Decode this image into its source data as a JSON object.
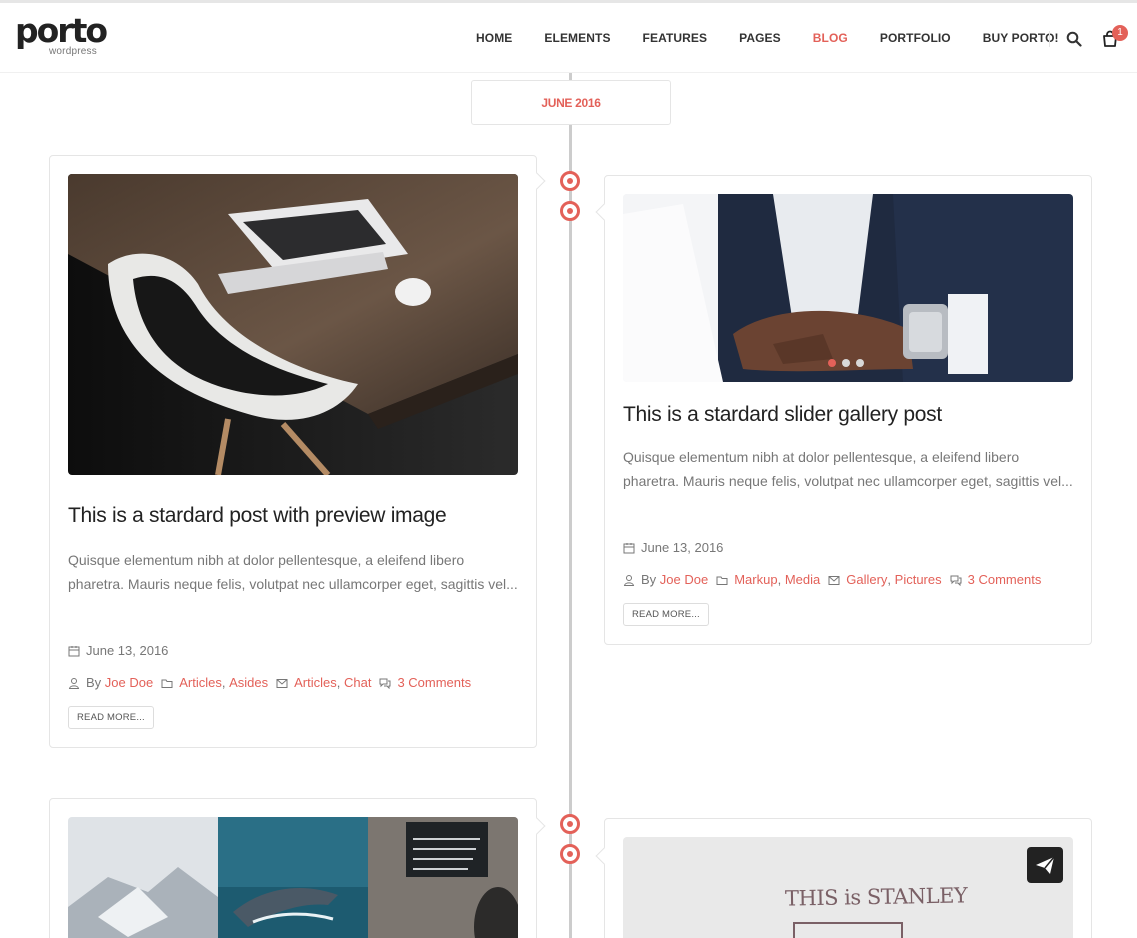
{
  "brand": {
    "name": "porto",
    "sub": "wordpress"
  },
  "nav": {
    "items": [
      {
        "label": "HOME"
      },
      {
        "label": "ELEMENTS"
      },
      {
        "label": "FEATURES"
      },
      {
        "label": "PAGES"
      },
      {
        "label": "BLOG",
        "active": true
      },
      {
        "label": "PORTFOLIO"
      },
      {
        "label": "BUY PORTO!"
      }
    ],
    "cart_count": "1"
  },
  "timeline": {
    "month": "JUNE 2016"
  },
  "posts": [
    {
      "title": "This is a stardard post with preview image",
      "excerpt": "Quisque elementum nibh at dolor pellentesque, a eleifend libero pharetra. Mauris neque felis, volutpat nec ullamcorper eget, sagittis vel...",
      "date": "June 13, 2016",
      "by": "By",
      "author": "Joe Doe",
      "categories": [
        "Articles",
        "Asides"
      ],
      "tags": [
        "Articles",
        "Chat"
      ],
      "comments": "3 Comments",
      "read_more": "READ MORE..."
    },
    {
      "title": "This is a stardard slider gallery post",
      "excerpt": "Quisque elementum nibh at dolor pellentesque, a eleifend libero pharetra. Mauris neque felis, volutpat nec ullamcorper eget, sagittis vel...",
      "date": "June 13, 2016",
      "by": "By",
      "author": "Joe Doe",
      "categories": [
        "Markup",
        "Media"
      ],
      "tags": [
        "Gallery",
        "Pictures"
      ],
      "comments": "3 Comments",
      "read_more": "READ MORE...",
      "slider_active": 1,
      "slider_count": 3
    },
    {
      "image_text": "THIS is STANLEY"
    }
  ],
  "colors": {
    "accent": "#e36159",
    "text": "#777777",
    "heading": "#222222",
    "border": "#e5e5e5"
  }
}
